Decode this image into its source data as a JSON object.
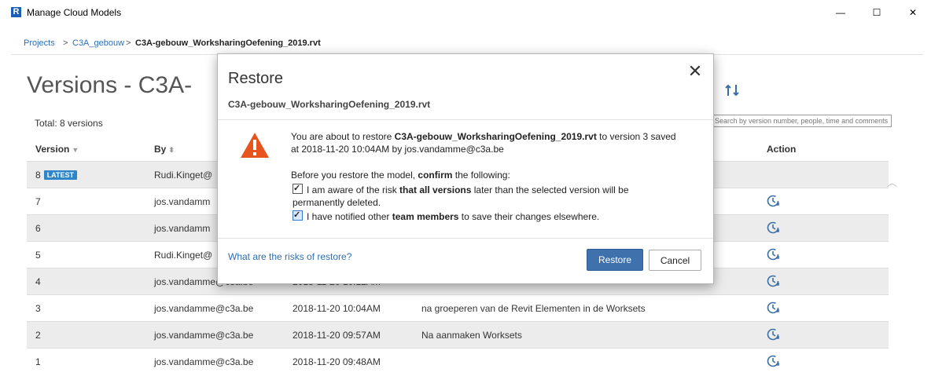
{
  "window": {
    "app_logo_letter": "R",
    "title": "Manage Cloud Models",
    "min_glyph": "—",
    "max_glyph": "☐",
    "close_glyph": "✕"
  },
  "breadcrumb": {
    "items": [
      "Projects",
      "C3A_gebouw",
      "C3A-gebouw_WorksharingOefening_2019.rvt"
    ],
    "separator": ">"
  },
  "page": {
    "title": "Versions - C3A-",
    "total": "Total: 8 versions",
    "search_placeholder": "Search by version number, people, time and comments"
  },
  "table": {
    "headers": [
      "Version",
      "By",
      "Action"
    ],
    "latest_badge": "LATEST",
    "rows": [
      {
        "version": "8",
        "by": "Rudi.Kinget@",
        "date": "",
        "comment": "",
        "latest": true
      },
      {
        "version": "7",
        "by": "jos.vandamm",
        "date": "",
        "comment": ""
      },
      {
        "version": "6",
        "by": "jos.vandamm",
        "date": "",
        "comment": ""
      },
      {
        "version": "5",
        "by": "Rudi.Kinget@",
        "date": "",
        "comment": ""
      },
      {
        "version": "4",
        "by": "jos.vandamme@c3a.be",
        "date": "2018-11-20 10:12AM",
        "comment": ""
      },
      {
        "version": "3",
        "by": "jos.vandamme@c3a.be",
        "date": "2018-11-20 10:04AM",
        "comment": "na groeperen van de Revit Elementen in de Worksets"
      },
      {
        "version": "2",
        "by": "jos.vandamme@c3a.be",
        "date": "2018-11-20 09:57AM",
        "comment": "Na aanmaken Worksets"
      },
      {
        "version": "1",
        "by": "jos.vandamme@c3a.be",
        "date": "2018-11-20 09:48AM",
        "comment": ""
      }
    ]
  },
  "dialog": {
    "title": "Restore",
    "subtitle": "C3A-gebouw_WorksharingOefening_2019.rvt",
    "close_glyph": "✕",
    "msg_prefix": "You are about to restore ",
    "msg_file": "C3A-gebouw_WorksharingOefening_2019.rvt",
    "msg_suffix": " to version 3 saved at 2018-11-20 10:04AM by jos.vandamme@c3a.be",
    "before_prefix": "Before you restore the model, ",
    "before_bold": "confirm",
    "before_suffix": " the following:",
    "check1_prefix": "I am aware of the risk ",
    "check1_bold": "that all versions",
    "check1_suffix": " later than the selected version will be permanently deleted.",
    "check2_prefix": "I have notified other ",
    "check2_bold": "team members",
    "check2_suffix": " to save their changes elsewhere.",
    "risk_link": "What are the risks of restore?",
    "restore_label": "Restore",
    "cancel_label": "Cancel"
  },
  "colors": {
    "accent": "#3f72ad",
    "link": "#2d6fb5",
    "badge": "#2e86c8",
    "warning": "#e8541e"
  }
}
